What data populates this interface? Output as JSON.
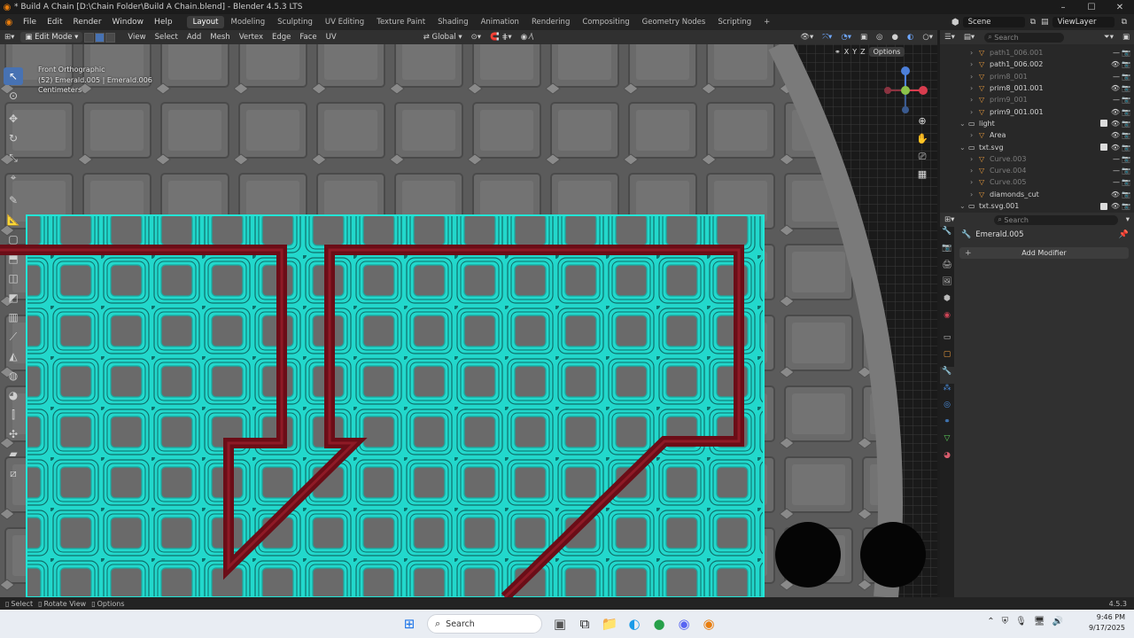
{
  "window": {
    "title": "* Build A Chain [D:\\Chain Folder\\Build A Chain.blend] - Blender 4.5.3 LTS",
    "min": "–",
    "max": "☐",
    "close": "✕"
  },
  "menu": [
    "File",
    "Edit",
    "Render",
    "Window",
    "Help"
  ],
  "workspaces": [
    "Layout",
    "Modeling",
    "Sculpting",
    "UV Editing",
    "Texture Paint",
    "Shading",
    "Animation",
    "Rendering",
    "Compositing",
    "Geometry Nodes",
    "Scripting"
  ],
  "active_workspace": "Layout",
  "add_workspace": "+",
  "scene": "Scene",
  "view_layer": "ViewLayer",
  "viewport_header": {
    "mode": "Edit Mode",
    "menus": [
      "View",
      "Select",
      "Add",
      "Mesh",
      "Vertex",
      "Edge",
      "Face",
      "UV"
    ],
    "orientation": "Global",
    "options": "Options",
    "axes": [
      "X",
      "Y",
      "Z"
    ]
  },
  "overlay": {
    "view_name": "Front Orthographic",
    "objects": "(52) Emerald.005 | Emerald.006",
    "units": "Centimeters"
  },
  "gizmo": {
    "x": "X",
    "y": "Y",
    "z": "Z"
  },
  "outliner": {
    "search_placeholder": "Search",
    "rows": [
      {
        "name": "path1_006.001",
        "dim": true,
        "indent": 1
      },
      {
        "name": "path1_006.002",
        "dim": false,
        "indent": 1
      },
      {
        "name": "prim8_001",
        "dim": true,
        "indent": 1
      },
      {
        "name": "prim8_001.001",
        "dim": false,
        "indent": 1
      },
      {
        "name": "prim9_001",
        "dim": true,
        "indent": 1
      },
      {
        "name": "prim9_001.001",
        "dim": false,
        "indent": 1
      },
      {
        "name": "light",
        "dim": false,
        "indent": 0
      },
      {
        "name": "Area",
        "dim": false,
        "indent": 1
      },
      {
        "name": "txt.svg",
        "dim": false,
        "indent": 0
      },
      {
        "name": "Curve.003",
        "dim": true,
        "indent": 1
      },
      {
        "name": "Curve.004",
        "dim": true,
        "indent": 1
      },
      {
        "name": "Curve.005",
        "dim": true,
        "indent": 1
      },
      {
        "name": "diamonds_cut",
        "dim": false,
        "indent": 1
      },
      {
        "name": "txt.svg.001",
        "dim": false,
        "indent": 0
      }
    ]
  },
  "properties": {
    "search_placeholder": "Search",
    "object_name": "Emerald.005",
    "add_modifier": "Add Modifier"
  },
  "statusbar": {
    "items": [
      "Select",
      "Rotate View",
      "Options"
    ],
    "version": "4.5.3"
  },
  "taskbar": {
    "search": "Search",
    "time": "9:46 PM",
    "date": "9/17/2025"
  },
  "colors": {
    "mesh_wire": "#22e5d6",
    "chain": "#6b0d17",
    "viewport_bg": "#5b5b5b",
    "accent": "#4772b3",
    "blender_orange": "#e87d0d"
  }
}
